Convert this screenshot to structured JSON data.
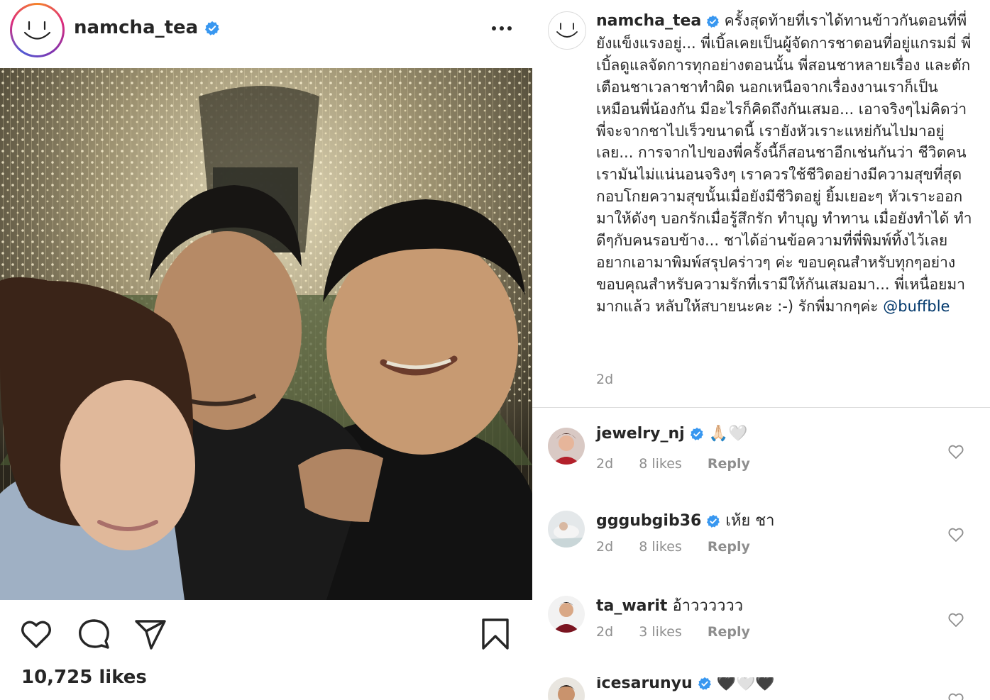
{
  "post": {
    "username": "namcha_tea",
    "likes": "10,725 likes"
  },
  "caption": {
    "username": "namcha_tea",
    "text": "ครั้งสุดท้ายที่เราได้ทานข้าวกันตอนที่พี่ยังแข็งแรงอยู่... พี่เบิ้ลเคยเป็นผู้จัดการชาตอนที่อยู่แกรมมี่ พี่เบิ้ลดูแลจัดการทุกอย่างตอนนั้น พี่สอนชาหลายเรื่อง และตักเตือนชาเวลาชาทำผิด นอกเหนือจากเรื่องงานเราก็เป็นเหมือนพี่น้องกัน มีอะไรก็คิดถึงกันเสมอ... เอาจริงๆไม่คิดว่าพี่จะจากชาไปเร็วขนาดนี้ เรายังหัวเราะแหย่กันไปมาอยู่เลย... การจากไปของพี่ครั้งนี้ก็สอนชาอีกเช่นกันว่า ชีวิตคนเรามันไม่แน่นอนจริงๆ เราควรใช้ชีวิตอย่างมีความสุขที่สุด กอบโกยความสุขนั้นเมื่อยังมีชีวิตอยู่ ยิ้มเยอะๆ หัวเราะออกมาให้ดังๆ บอกรักเมื่อรู้สึกรัก ทำบุญ ทำทาน เมื่อยังทำได้ ทำดีๆกับคนรอบข้าง... ชาได้อ่านข้อความที่พี่พิมพ์ทิ้งไว้เลยอยากเอามาพิมพ์สรุปคร่าวๆ ค่ะ ขอบคุณสำหรับทุกๆอย่าง ขอบคุณสำหรับความรักที่เรามีให้กันเสมอมา... พี่เหนื่อยมามากแล้ว หลับให้สบายนะคะ :-) รักพี่มากๆค่ะ",
    "mention": "@buffble",
    "time": "2d"
  },
  "comments": [
    {
      "username": "jewelry_nj",
      "text": "🙏🏻🤍",
      "time": "2d",
      "likes": "8 likes",
      "reply": "Reply"
    },
    {
      "username": "gggubgib36",
      "text": "เห้ย ชา",
      "time": "2d",
      "likes": "8 likes",
      "reply": "Reply"
    },
    {
      "username": "ta_warit",
      "text": "อ้าวววววว",
      "time": "2d",
      "likes": "3 likes",
      "reply": "Reply"
    },
    {
      "username": "icesarunyu",
      "text": "🖤🤍🖤",
      "time": "",
      "likes": "",
      "reply": ""
    }
  ],
  "colors": {
    "verified": "#3897f0",
    "muted": "#8e8e8e",
    "text": "#262626",
    "link": "#00376b"
  },
  "icons": [
    "more-icon",
    "heart-icon",
    "comment-icon",
    "share-icon",
    "bookmark-icon",
    "verified-icon",
    "small-heart-icon"
  ]
}
